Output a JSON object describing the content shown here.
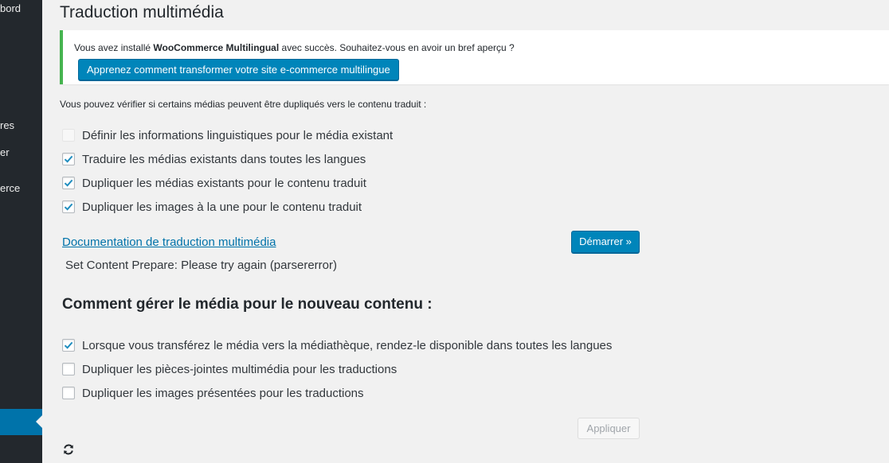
{
  "sidebar": {
    "items": [
      {
        "label": "bord"
      },
      {
        "label": "res"
      },
      {
        "label": "er"
      },
      {
        "label": "erce"
      }
    ]
  },
  "page": {
    "title": "Traduction multimédia"
  },
  "notice": {
    "text_before": "Vous avez installé ",
    "text_bold": "WooCommerce Multilingual",
    "text_after": " avec succès. Souhaitez-vous en avoir un bref aperçu ?",
    "button_label": "Apprenez comment transformer votre site e-commerce multilingue"
  },
  "intro": "Vous pouvez vérifier si certains médias peuvent être dupliqués vers le contenu traduit :",
  "options": [
    {
      "label": "Définir les informations linguistiques pour le média existant",
      "checked": false,
      "disabled": true
    },
    {
      "label": "Traduire les médias existants dans toutes les langues",
      "checked": true,
      "disabled": false
    },
    {
      "label": "Dupliquer les médias existants pour le contenu traduit",
      "checked": true,
      "disabled": false
    },
    {
      "label": "Dupliquer les images à la une pour le contenu traduit",
      "checked": true,
      "disabled": false
    }
  ],
  "doc_link": "Documentation de traduction multimédia",
  "start_button": "Démarrer »",
  "status": "Set Content Prepare: Please try again (parsererror)",
  "section": {
    "title": "Comment gérer le média pour le nouveau contenu :",
    "options": [
      {
        "label": "Lorsque vous transférez le média vers la médiathèque, rendez-le disponible dans toutes les langues",
        "checked": true
      },
      {
        "label": "Dupliquer les pièces-jointes multimédia pour les traductions",
        "checked": false
      },
      {
        "label": "Dupliquer les images présentées pour les traductions",
        "checked": false
      }
    ]
  },
  "apply_button": "Appliquer",
  "colors": {
    "accent": "#0085ba",
    "sidebar_bg": "#23282d",
    "notice_border": "#46b450",
    "link": "#0073aa",
    "check": "#1e8cbe"
  },
  "icons": {
    "refresh": "refresh-icon",
    "checkmark": "checkmark-icon"
  }
}
